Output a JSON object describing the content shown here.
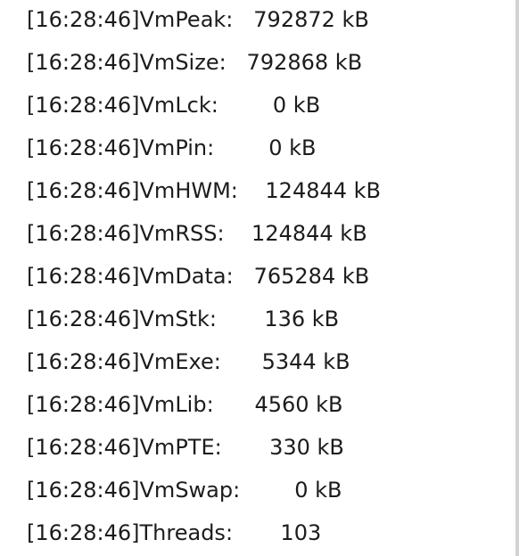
{
  "log_lines": [
    "[16:28:46]VmPeak:   792872 kB",
    "[16:28:46]VmSize:   792868 kB",
    "[16:28:46]VmLck:        0 kB",
    "[16:28:46]VmPin:        0 kB",
    "[16:28:46]VmHWM:    124844 kB",
    "[16:28:46]VmRSS:    124844 kB",
    "[16:28:46]VmData:   765284 kB",
    "[16:28:46]VmStk:       136 kB",
    "[16:28:46]VmExe:      5344 kB",
    "[16:28:46]VmLib:      4560 kB",
    "[16:28:46]VmPTE:       330 kB",
    "[16:28:46]VmSwap:        0 kB",
    "[16:28:46]Threads:       103"
  ]
}
